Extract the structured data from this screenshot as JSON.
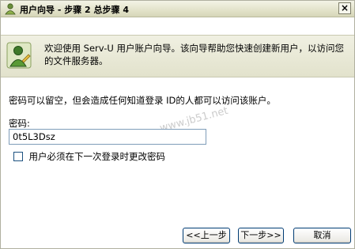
{
  "window": {
    "title": "用户向导  - 步骤  2 总步骤  4",
    "close_label": "×"
  },
  "header": {
    "description": "欢迎使用  Serv-U 用户账户向导。该向导帮助您快速创建新用户，以访问您的文件服务器。",
    "icon": "user-wizard-icon"
  },
  "body": {
    "notice": "密码可以留空，但会造成任何知道登录 ID的人都可以访问该账户。",
    "password_label": "密码:",
    "password_value": "0t5L3Dsz",
    "checkbox_label": "用户必须在下一次登录时更改密码",
    "checkbox_checked": false
  },
  "watermark": "www.jb51.net",
  "buttons": {
    "back": "<<上一步",
    "next": "下一步>>",
    "cancel": "取消"
  }
}
